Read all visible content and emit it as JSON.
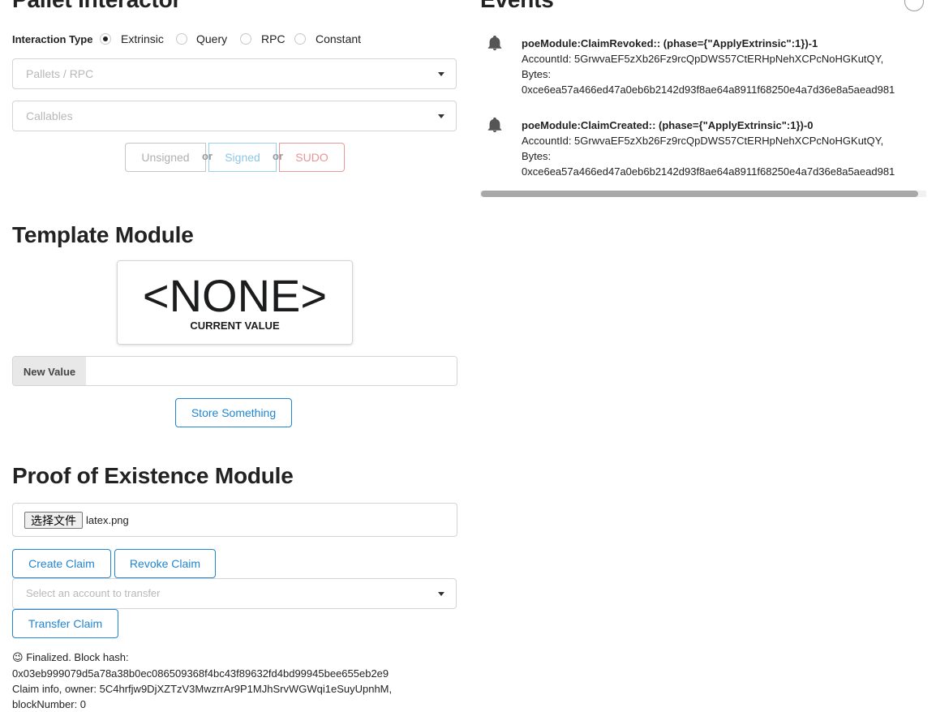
{
  "pallet": {
    "title": "Pallet Interactor",
    "interaction_type_label": "Interaction Type",
    "options": [
      "Extrinsic",
      "Query",
      "RPC",
      "Constant"
    ],
    "selected": "Extrinsic",
    "pallets_placeholder": "Pallets / RPC",
    "callables_placeholder": "Callables",
    "unsigned_label": "Unsigned",
    "or1": "or",
    "signed_label": "Signed",
    "or2": "or",
    "sudo_label": "SUDO"
  },
  "events": {
    "title": "Events",
    "items": [
      {
        "title": "poeModule:ClaimRevoked:: (phase={\"ApplyExtrinsic\":1})-1",
        "account": "AccountId: 5GrwvaEF5zXb26Fz9rcQpDWS57CtERHpNehXCPcNoHGKutQY,",
        "bytes_label": "Bytes:",
        "bytes": "0xce6ea57a466ed47a0eb6b2142d93f8ae64a8911f68250e4a7d36e8a5aead981"
      },
      {
        "title": "poeModule:ClaimCreated:: (phase={\"ApplyExtrinsic\":1})-0",
        "account": "AccountId: 5GrwvaEF5zXb26Fz9rcQpDWS57CtERHpNehXCPcNoHGKutQY,",
        "bytes_label": "Bytes:",
        "bytes": "0xce6ea57a466ed47a0eb6b2142d93f8ae64a8911f68250e4a7d36e8a5aead981"
      }
    ]
  },
  "template": {
    "title": "Template Module",
    "current_value": "<NONE>",
    "current_value_label": "CURRENT VALUE",
    "new_value_label": "New Value",
    "new_value": "",
    "store_button": "Store Something"
  },
  "poe": {
    "title": "Proof of Existence Module",
    "file_button": "选择文件",
    "file_name": "latex.png",
    "create_button": "Create Claim",
    "revoke_button": "Revoke Claim",
    "transfer_placeholder": "Select an account to transfer",
    "transfer_button": "Transfer Claim",
    "status_emoji": "😉",
    "status_line1": "Finalized. Block hash:",
    "status_line2": "0x03eb999079d5a78a38b0ec086509368f4bc43f89632fd4bd99945bee655eb2e9",
    "status_line3": "Claim info, owner: 5C4hrfjw9DjXZTzV3MwzrrAr9P1MJhSrvWGWqi1eSuyUpnhM,",
    "status_line4": "blockNumber: 0"
  }
}
